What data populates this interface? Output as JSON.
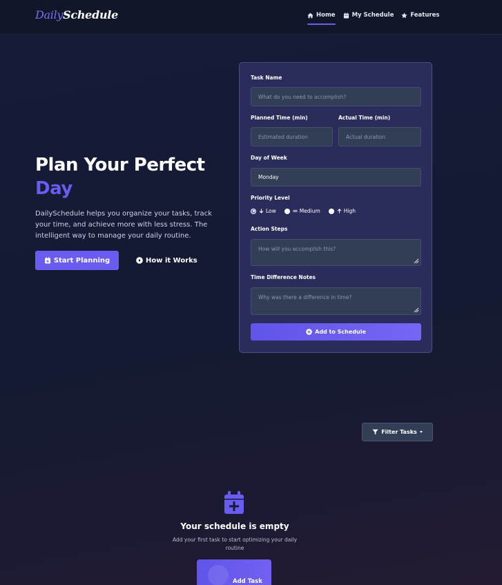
{
  "brand": {
    "part1": "Daily",
    "part2": "Schedule"
  },
  "nav": [
    {
      "label": "Home",
      "icon": "home-icon",
      "active": true
    },
    {
      "label": "My Schedule",
      "icon": "calendar-icon",
      "active": false
    },
    {
      "label": "Features",
      "icon": "star-icon",
      "active": false
    }
  ],
  "hero": {
    "title_line1": "Plan Your Perfect",
    "title_accent": "Day",
    "description": "DailySchedule helps you organize your tasks, track your time, and achieve more with less stress. The intelligent way to manage your daily routine.",
    "primary_button": "Start Planning",
    "secondary_button": "How it Works"
  },
  "form": {
    "task_name": {
      "label": "Task Name",
      "placeholder": "What do you need to accomplish?"
    },
    "planned_time": {
      "label": "Planned Time (min)",
      "placeholder": "Estimated duration"
    },
    "actual_time": {
      "label": "Actual Time (min)",
      "placeholder": "Actual duration"
    },
    "day_of_week": {
      "label": "Day of Week",
      "value": "Monday"
    },
    "priority": {
      "label": "Priority Level",
      "options": [
        {
          "label": "Low",
          "icon": "arrow-down-icon",
          "selected": true
        },
        {
          "label": "Medium",
          "icon": "equals-icon",
          "selected": false
        },
        {
          "label": "High",
          "icon": "arrow-up-icon",
          "selected": false
        }
      ]
    },
    "action_steps": {
      "label": "Action Steps",
      "placeholder": "How will you accomplish this?"
    },
    "time_notes": {
      "label": "Time Difference Notes",
      "placeholder": "Why was there a difference in time?"
    },
    "submit_button": "Add to Schedule"
  },
  "filter_button": "Filter Tasks",
  "empty_state": {
    "title": "Your schedule is empty",
    "subtitle": "Add your first task to start optimizing your daily routine",
    "button": "Add Task"
  },
  "colors": {
    "accent": "#6a5cf0",
    "background": "#161c38",
    "card": "#2a2d5c",
    "input": "#323e55"
  }
}
